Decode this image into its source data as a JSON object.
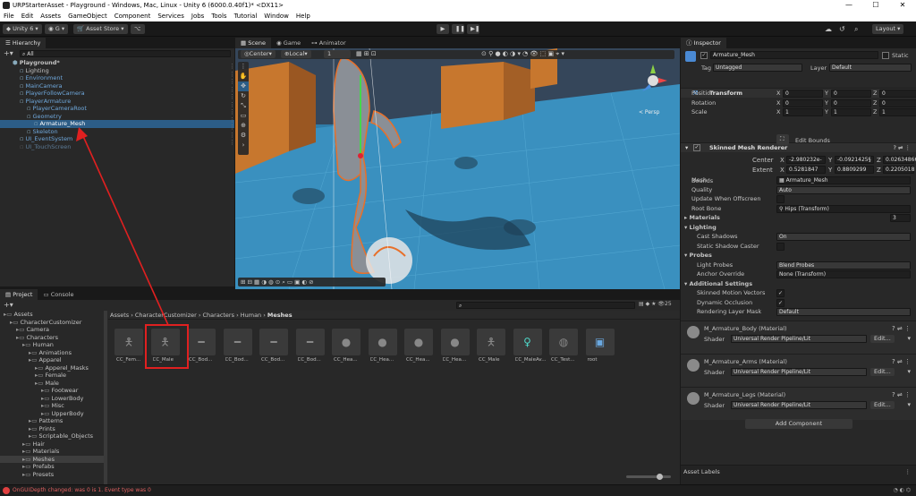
{
  "window": {
    "title": "URPStarterAsset - Playground - Windows, Mac, Linux - Unity 6 (6000.0.40f1)* <DX11>",
    "controls": [
      "—",
      "☐",
      "✕"
    ]
  },
  "menu": [
    "File",
    "Edit",
    "Assets",
    "GameObject",
    "Component",
    "Services",
    "Jobs",
    "Tools",
    "Tutorial",
    "Window",
    "Help"
  ],
  "toolbar": {
    "account": "Unity 6",
    "g_label": "G",
    "asset_store": "Asset Store",
    "layout": "Layout"
  },
  "hierarchy": {
    "tab": "Hierarchy",
    "search": "All",
    "items": [
      {
        "label": "Playground*",
        "indent": 0,
        "style": "root"
      },
      {
        "label": "Lighting",
        "indent": 1,
        "style": "normal"
      },
      {
        "label": "Environment",
        "indent": 1,
        "style": "blue"
      },
      {
        "label": "MainCamera",
        "indent": 1,
        "style": "blue"
      },
      {
        "label": "PlayerFollowCamera",
        "indent": 1,
        "style": "blue"
      },
      {
        "label": "PlayerArmature",
        "indent": 1,
        "style": "blue"
      },
      {
        "label": "PlayerCameraRoot",
        "indent": 2,
        "style": "blue"
      },
      {
        "label": "Geometry",
        "indent": 2,
        "style": "blue"
      },
      {
        "label": "Armature_Mesh",
        "indent": 3,
        "style": "selected"
      },
      {
        "label": "Skeleton",
        "indent": 2,
        "style": "blue"
      },
      {
        "label": "UI_EventSystem",
        "indent": 1,
        "style": "blue"
      },
      {
        "label": "UI_TouchScreen",
        "indent": 1,
        "style": "dim"
      }
    ]
  },
  "scene": {
    "tabs": [
      "Scene",
      "Game",
      "Animator"
    ],
    "pivot": "Center",
    "space": "Local",
    "grid": "1",
    "view_label": "< Persp"
  },
  "project": {
    "tabs": [
      "Project",
      "Console"
    ],
    "breadcrumb": [
      "Assets",
      "CharacterCustomizer",
      "Characters",
      "Human",
      "Meshes"
    ],
    "count": "25",
    "tree": [
      {
        "label": "Assets",
        "indent": 0
      },
      {
        "label": "CharacterCustomizer",
        "indent": 1
      },
      {
        "label": "Camera",
        "indent": 2
      },
      {
        "label": "Characters",
        "indent": 2
      },
      {
        "label": "Human",
        "indent": 3
      },
      {
        "label": "Animations",
        "indent": 4
      },
      {
        "label": "Apparel",
        "indent": 4
      },
      {
        "label": "Apperel_Masks",
        "indent": 5
      },
      {
        "label": "Female",
        "indent": 5
      },
      {
        "label": "Male",
        "indent": 5
      },
      {
        "label": "Footwear",
        "indent": 6
      },
      {
        "label": "LowerBody",
        "indent": 6
      },
      {
        "label": "Misc",
        "indent": 6
      },
      {
        "label": "UpperBody",
        "indent": 6
      },
      {
        "label": "Patterns",
        "indent": 4
      },
      {
        "label": "Prints",
        "indent": 4
      },
      {
        "label": "Scriptable_Objects",
        "indent": 4
      },
      {
        "label": "Hair",
        "indent": 3
      },
      {
        "label": "Materials",
        "indent": 3
      },
      {
        "label": "Meshes",
        "indent": 3,
        "selected": true
      },
      {
        "label": "Prefabs",
        "indent": 3
      },
      {
        "label": "Presets",
        "indent": 3
      }
    ],
    "assets": [
      "CC_Fem...",
      "CC_Male",
      "CC_Bod...",
      "CC_Bod...",
      "CC_Bod...",
      "CC_Bod...",
      "CC_Hea...",
      "CC_Hea...",
      "CC_Hea...",
      "CC_Hea...",
      "CC_Male",
      "CC_MaleAv...",
      "CC_Test...",
      "root"
    ]
  },
  "inspector": {
    "tab": "Inspector",
    "object_name": "Armature_Mesh",
    "static_label": "Static",
    "tag_label": "Tag",
    "tag": "Untagged",
    "layer_label": "Layer",
    "layer": "Default",
    "transform": {
      "title": "Transform",
      "rows": [
        {
          "label": "Position",
          "x": "0",
          "y": "0",
          "z": "0"
        },
        {
          "label": "Rotation",
          "x": "0",
          "y": "0",
          "z": "0"
        },
        {
          "label": "Scale",
          "x": "1",
          "y": "1",
          "z": "1"
        }
      ]
    },
    "smr": {
      "title": "Skinned Mesh Renderer",
      "edit_bounds": "Edit Bounds",
      "bounds": "Bounds",
      "center_label": "Center",
      "center": {
        "x": "-2.980232e-",
        "y": "-0.0921425§",
        "z": "0.02634866"
      },
      "extent_label": "Extent",
      "extent": {
        "x": "0.5281847",
        "y": "0.8809299",
        "z": "0.2205018"
      },
      "mesh_label": "Mesh",
      "mesh": "Armature_Mesh",
      "quality_label": "Quality",
      "quality": "Auto",
      "update_label": "Update When Offscreen",
      "root_bone_label": "Root Bone",
      "root_bone": "Hips (Transform)",
      "materials_label": "Materials",
      "materials_count": "3",
      "lighting_label": "Lighting",
      "cast_label": "Cast Shadows",
      "cast": "On",
      "static_caster_label": "Static Shadow Caster",
      "probes_label": "Probes",
      "light_probes_label": "Light Probes",
      "light_probes": "Blend Probes",
      "anchor_label": "Anchor Override",
      "anchor": "None (Transform)",
      "additional_label": "Additional Settings",
      "skinned_motion_label": "Skinned Motion Vectors",
      "dynamic_occ_label": "Dynamic Occlusion",
      "rlm_label": "Rendering Layer Mask",
      "rlm": "Default"
    },
    "materials": [
      {
        "name": "M_Armature_Body (Material)",
        "shader_label": "Shader",
        "shader": "Universal Render Pipeline/Lit",
        "edit": "Edit..."
      },
      {
        "name": "M_Armature_Arms (Material)",
        "shader_label": "Shader",
        "shader": "Universal Render Pipeline/Lit",
        "edit": "Edit..."
      },
      {
        "name": "M_Armature_Legs (Material)",
        "shader_label": "Shader",
        "shader": "Universal Render Pipeline/Lit",
        "edit": "Edit..."
      }
    ],
    "add_component": "Add Component",
    "asset_labels": "Asset Labels"
  },
  "status": {
    "message": "OnGUIDepth changed: was 0 is 1. Event type was 0"
  },
  "colors": {
    "accent": "#2c5d87",
    "annotation": "#e02020",
    "error": "#e04040"
  }
}
